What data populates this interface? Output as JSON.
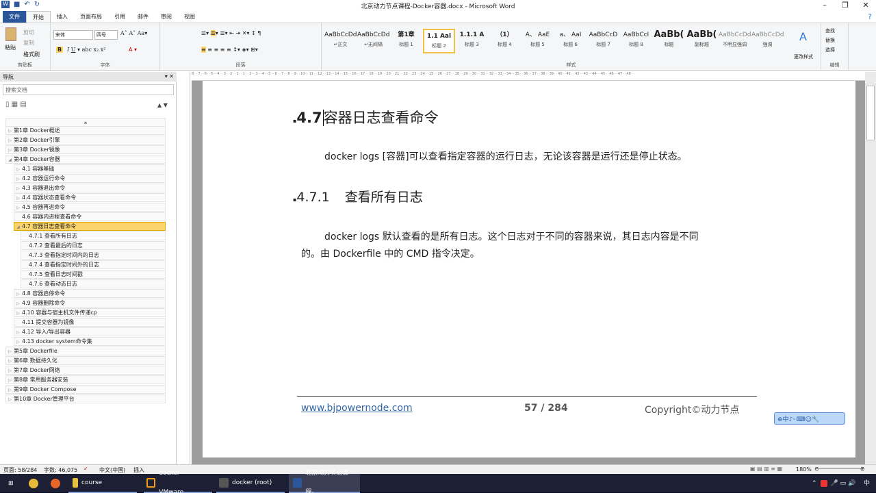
{
  "window": {
    "title": "北京动力节点课程-Docker容器.docx - Microsoft Word"
  },
  "tabs": [
    "文件",
    "开始",
    "插入",
    "页面布局",
    "引用",
    "邮件",
    "审阅",
    "视图"
  ],
  "ribbon": {
    "clipboard": {
      "label": "剪贴板",
      "paste": "粘贴",
      "cut": "剪切",
      "copy": "复制",
      "format_painter": "格式刷"
    },
    "font": {
      "label": "字体",
      "font_name": "宋体",
      "font_size": "四号"
    },
    "paragraph": {
      "label": "段落"
    },
    "styles": {
      "label": "样式",
      "items": [
        {
          "preview": "AaBbCcDd",
          "name": "↵正文"
        },
        {
          "preview": "AaBbCcDd",
          "name": "↵无间隔"
        },
        {
          "preview": "第1章",
          "name": "标题 1"
        },
        {
          "preview": "1.1 Aal",
          "name": "标题 2"
        },
        {
          "preview": "1.1.1 A",
          "name": "标题 3"
        },
        {
          "preview": "（1）",
          "name": "标题 4"
        },
        {
          "preview": "A、 AaE",
          "name": "标题 5"
        },
        {
          "preview": "a、 AaI",
          "name": "标题 6"
        },
        {
          "preview": "AaBbCcD",
          "name": "标题 7"
        },
        {
          "preview": "AaBbCcI",
          "name": "标题 8"
        },
        {
          "preview": "AaBb(",
          "name": "标题"
        },
        {
          "preview": "AaBb(",
          "name": "副标题"
        },
        {
          "preview": "AaBbCcDd",
          "name": "不明显强调"
        },
        {
          "preview": "AaBbCcDd",
          "name": "强调"
        }
      ],
      "change_styles": "更改样式"
    },
    "editing": {
      "label": "编辑",
      "find": "查找",
      "replace": "替换",
      "select": "选择"
    }
  },
  "nav": {
    "title": "导航",
    "search_placeholder": "搜索文档",
    "items": [
      {
        "level": 0,
        "text": "第1章 Docker概述"
      },
      {
        "level": 0,
        "text": "第2章  Docker引擎"
      },
      {
        "level": 0,
        "text": "第3章 Docker镜像"
      },
      {
        "level": 0,
        "text": "第4章 Docker容器",
        "expanded": true
      },
      {
        "level": 1,
        "text": "4.1 容器基础"
      },
      {
        "level": 1,
        "text": "4.2 容器运行命令"
      },
      {
        "level": 1,
        "text": "4.3 容器退出命令"
      },
      {
        "level": 1,
        "text": "4.4 容器状态查看命令"
      },
      {
        "level": 1,
        "text": "4.5 容器再进命令"
      },
      {
        "level": 1,
        "text": "4.6 容器内进程查看命令",
        "leaf": true
      },
      {
        "level": 1,
        "text": "4.7 容器日志查看命令",
        "selected": true,
        "expanded": true
      },
      {
        "level": 2,
        "text": "4.7.1 查看所有日志"
      },
      {
        "level": 2,
        "text": "4.7.2 查看最后的日志"
      },
      {
        "level": 2,
        "text": "4.7.3 查看指定时间内的日志"
      },
      {
        "level": 2,
        "text": "4.7.4 查看指定时间外的日志"
      },
      {
        "level": 2,
        "text": "4.7.5 查看日志时间戳"
      },
      {
        "level": 2,
        "text": "4.7.6 查看动态日志"
      },
      {
        "level": 1,
        "text": "4.8 容器启停命令"
      },
      {
        "level": 1,
        "text": "4.9 容器删除命令"
      },
      {
        "level": 1,
        "text": "4.10 容器与宿主机文件传递cp"
      },
      {
        "level": 1,
        "text": "4.11 提交容器为镜像",
        "leaf": true
      },
      {
        "level": 1,
        "text": "4.12 导入/导出容器"
      },
      {
        "level": 1,
        "text": "4.13 docker system命令集"
      },
      {
        "level": 0,
        "text": "第5章 Dockerfile"
      },
      {
        "level": 0,
        "text": "第6章 数据持久化"
      },
      {
        "level": 0,
        "text": "第7章 Docker网络"
      },
      {
        "level": 0,
        "text": "第8章 常用服务器安装"
      },
      {
        "level": 0,
        "text": "第9章 Docker Compose"
      },
      {
        "level": 0,
        "text": "第10章 Docker管理平台"
      }
    ]
  },
  "doc": {
    "h2_num": "4.7",
    "h2_text": "容器日志查看命令",
    "p1": "docker logs [容器]可以查看指定容器的运行日志，无论该容器是运行还是停止状态。",
    "h3_num": "4.7.1",
    "h3_text": "查看所有日志",
    "p2a": "docker logs 默认查看的是所有日志。这个日志对于不同的容器来说，其日志内容是不同",
    "p2b": "的。由 Dockerfile 中的 CMD 指令决定。",
    "footer_link": "www.bjpowernode.com",
    "footer_page": "57 / 284",
    "footer_copy": "Copyright©动力节点"
  },
  "status": {
    "page": "页面: 58/284",
    "words": "字数: 46,075",
    "lang": "中文(中国)",
    "mode": "插入",
    "zoom": "180%"
  },
  "taskbar": {
    "items": [
      "course",
      "docker - VMware...",
      "docker (root)",
      "北京动力节点课程-..."
    ],
    "ime": "中"
  }
}
